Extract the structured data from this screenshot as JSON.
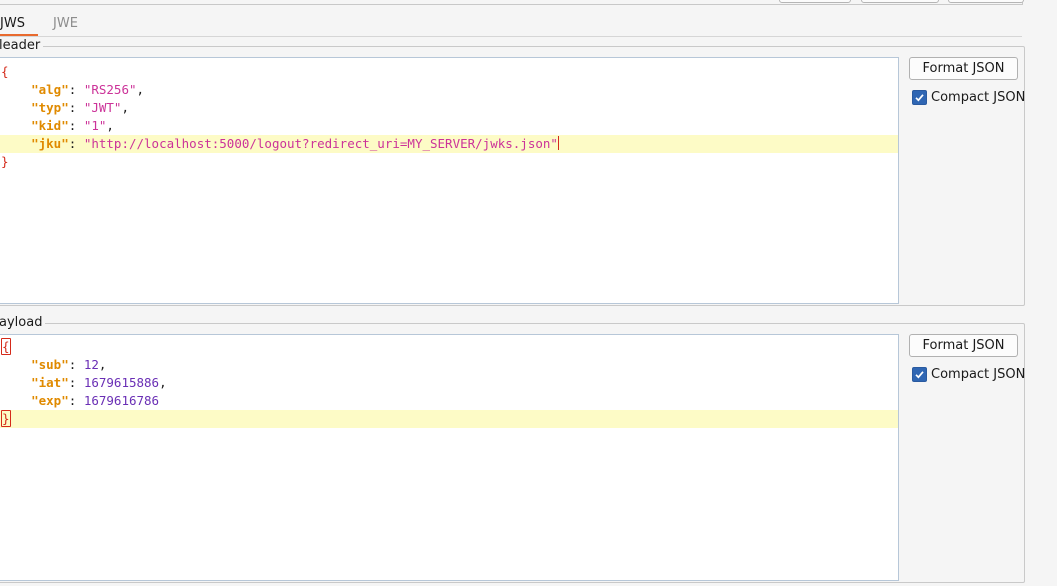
{
  "tabs": [
    {
      "label": "JWS",
      "active": true
    },
    {
      "label": "JWE",
      "active": false
    }
  ],
  "header_panel": {
    "title": "Header",
    "title_visible": "leader",
    "fields": {
      "alg": "\"RS256\"",
      "typ": "\"JWT\"",
      "kid": "\"1\"",
      "jku": "\"http://localhost:5000/logout?redirect_uri=MY_SERVER/jwks.json\""
    },
    "format_button_label": "Format JSON",
    "compact_label": "Compact JSON",
    "compact_checked": true
  },
  "payload_panel": {
    "title": "Payload",
    "title_visible": "ayload",
    "fields": {
      "sub": "12",
      "iat": "1679615886",
      "exp": "1679616786"
    },
    "format_button_label": "Format JSON",
    "compact_label": "Compact JSON",
    "compact_checked": true
  },
  "colors": {
    "tab_accent": "#e86a2e",
    "json_key": "#e08a00",
    "json_string": "#cc3399",
    "json_number": "#6a2fb5",
    "json_brace": "#d42a1a",
    "line_highlight": "#fdfbc6",
    "checkbox": "#2f66b3"
  }
}
